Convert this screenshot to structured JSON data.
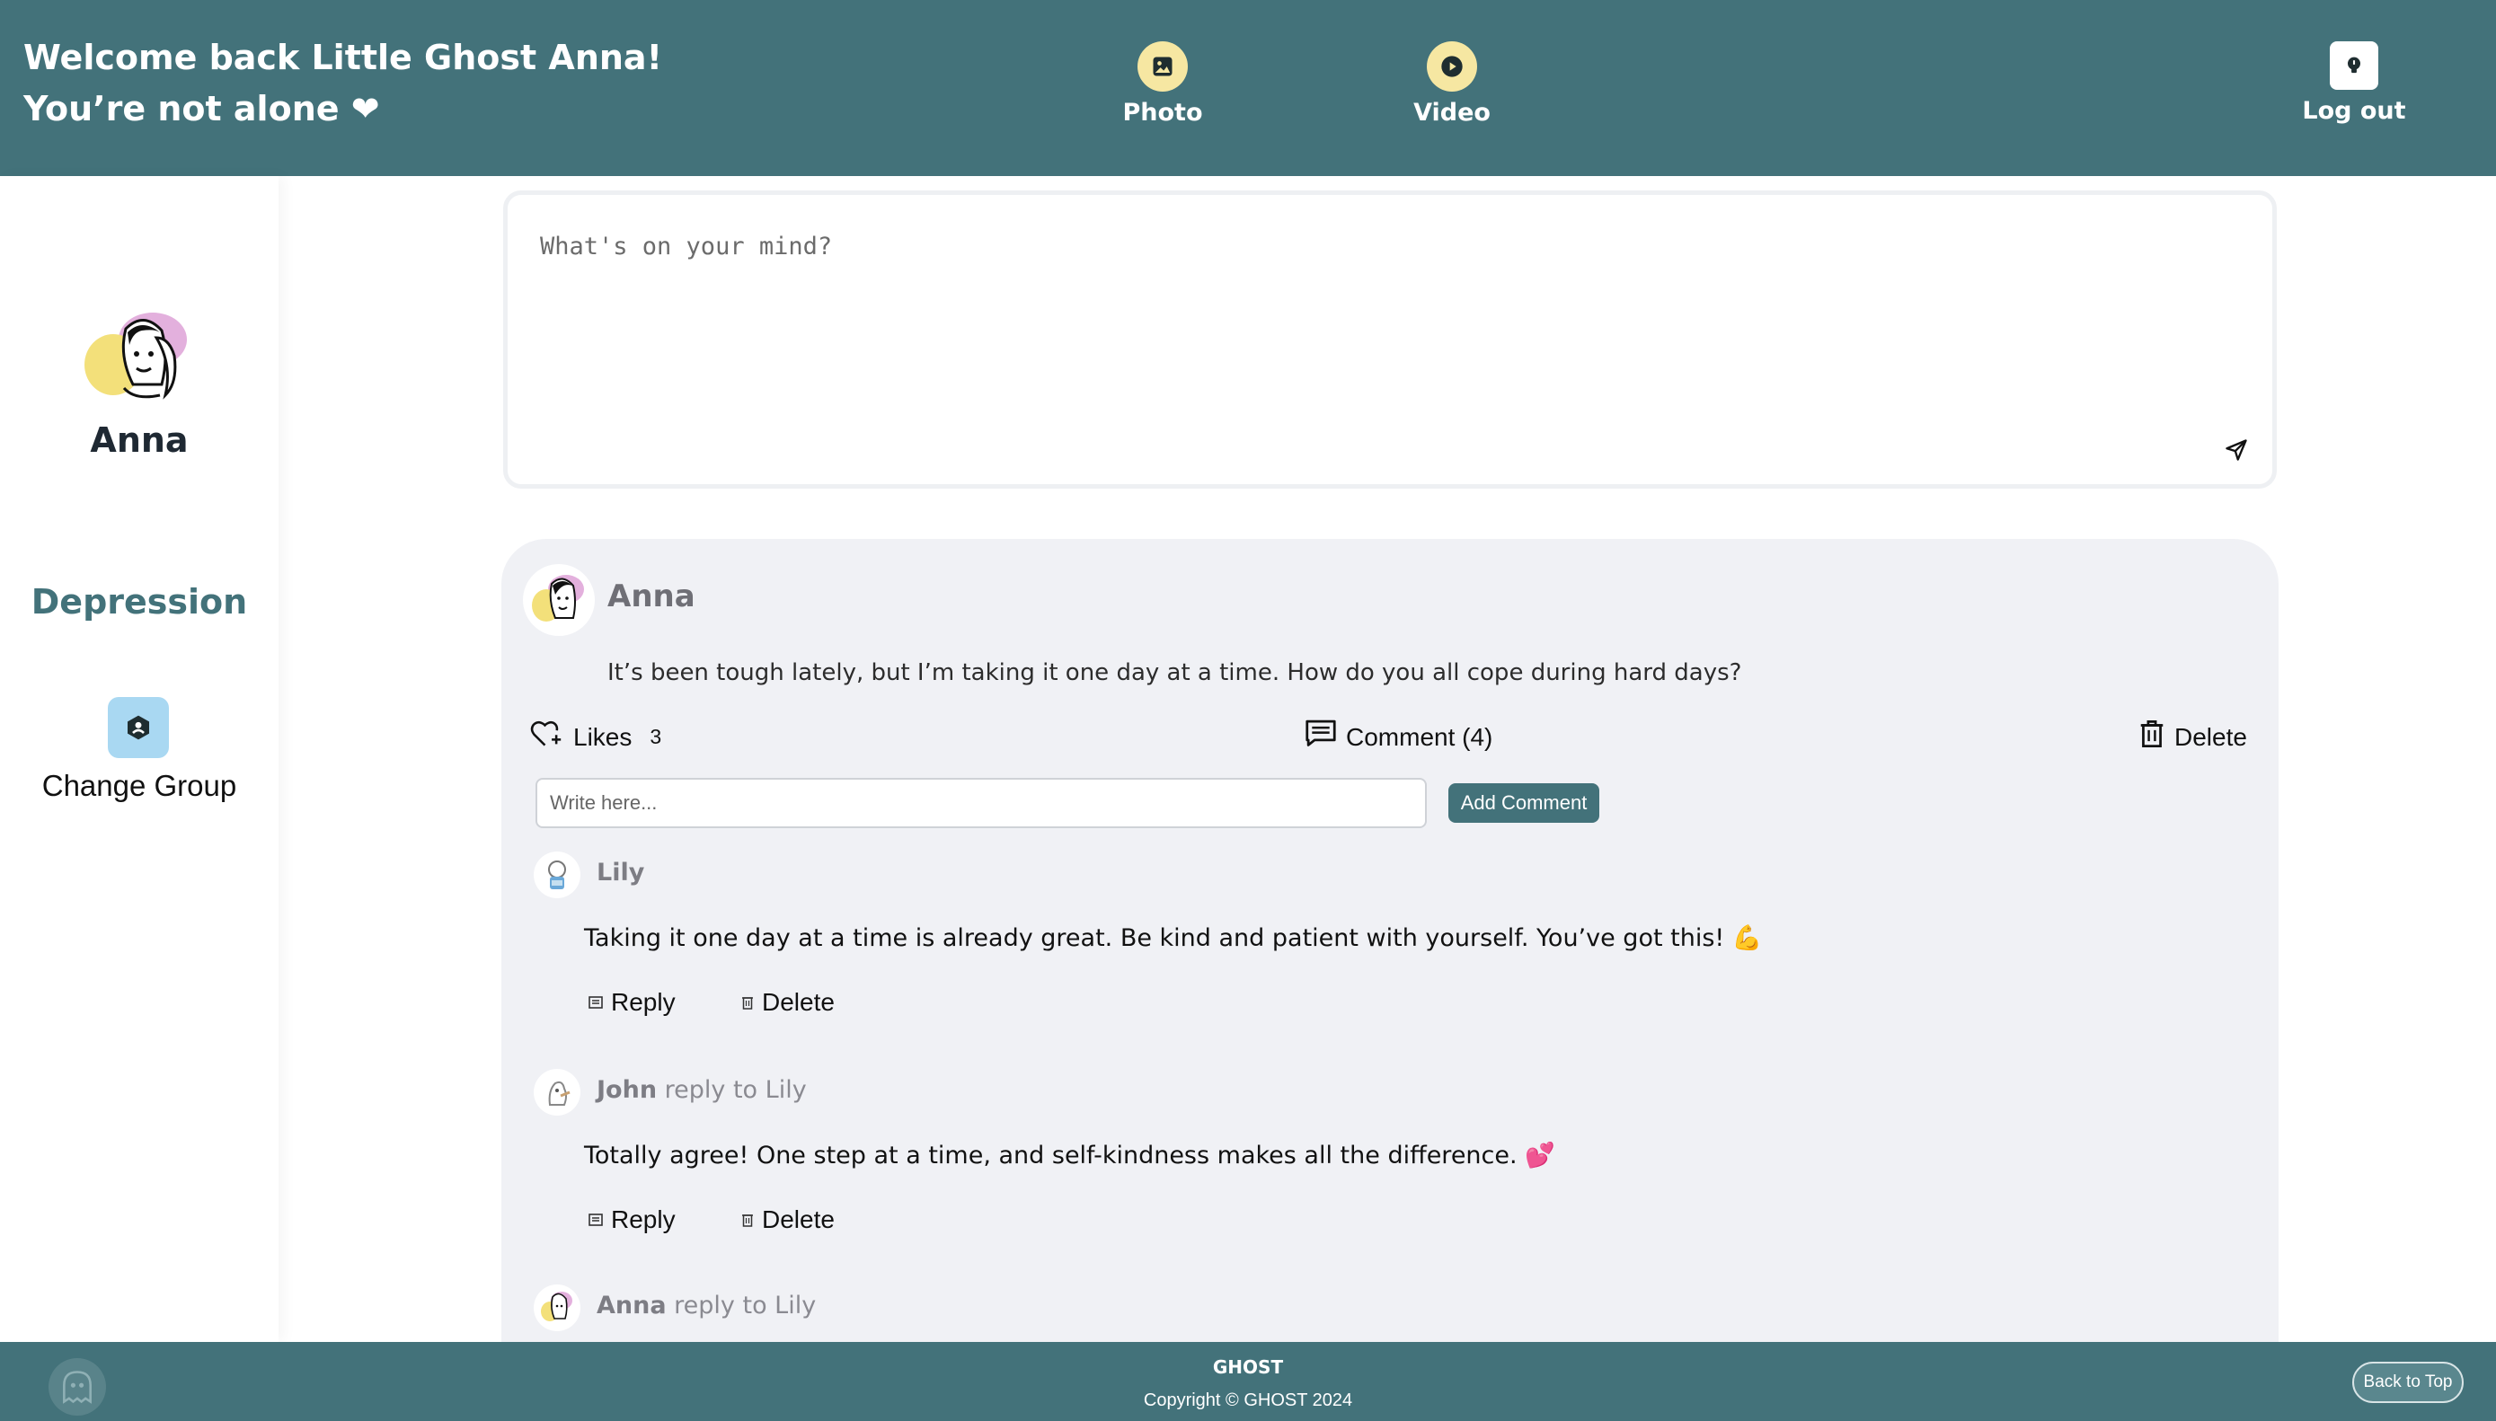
{
  "header": {
    "welcome_line1": "Welcome back Little Ghost Anna!",
    "welcome_line2": "You’re not alone ❤",
    "nav": {
      "photo": "Photo",
      "video": "Video",
      "logout": "Log out"
    }
  },
  "sidebar": {
    "name": "Anna",
    "group": "Depression",
    "change_group": "Change Group"
  },
  "composer": {
    "placeholder": "What's on your mind?"
  },
  "post": {
    "author": "Anna",
    "text": "It’s been tough lately, but I’m taking it one day at a time. How do you all cope during hard days?",
    "likes_label": "Likes",
    "likes_count": "3",
    "comment_label": "Comment (4)",
    "delete_label": "Delete",
    "comment_placeholder": "Write here...",
    "add_comment_label": "Add Comment",
    "comments": [
      {
        "author": "Lily",
        "reply_to": "",
        "text": "Taking it one day at a time is already great. Be kind and patient with yourself. You’ve got this! 💪",
        "reply_label": "Reply",
        "delete_label": "Delete"
      },
      {
        "author": "John",
        "reply_to": "reply to Lily",
        "text": "Totally agree! One step at a time, and self-kindness makes all the difference. 💕",
        "reply_label": "Reply",
        "delete_label": "Delete"
      },
      {
        "author": "Anna",
        "reply_to": "reply to Lily"
      }
    ]
  },
  "footer": {
    "title": "GHOST",
    "copyright": "Copyright © GHOST 2024",
    "back_to_top": "Back to Top"
  },
  "colors": {
    "primary": "#43727a",
    "nav_icon_bg": "#f6e7a2",
    "card_bg": "#f0f1f5",
    "group_icon_bg": "#a9d8f2"
  },
  "icons": {
    "photo": "photo-icon",
    "video": "play-icon",
    "logout": "lightbulb-icon",
    "change_group": "group-switch-icon",
    "send": "send-icon",
    "likes": "heart-plus-icon",
    "comment": "comment-icon",
    "delete": "trash-icon",
    "reply": "reply-icon",
    "footer_logo": "ghost-icon"
  }
}
